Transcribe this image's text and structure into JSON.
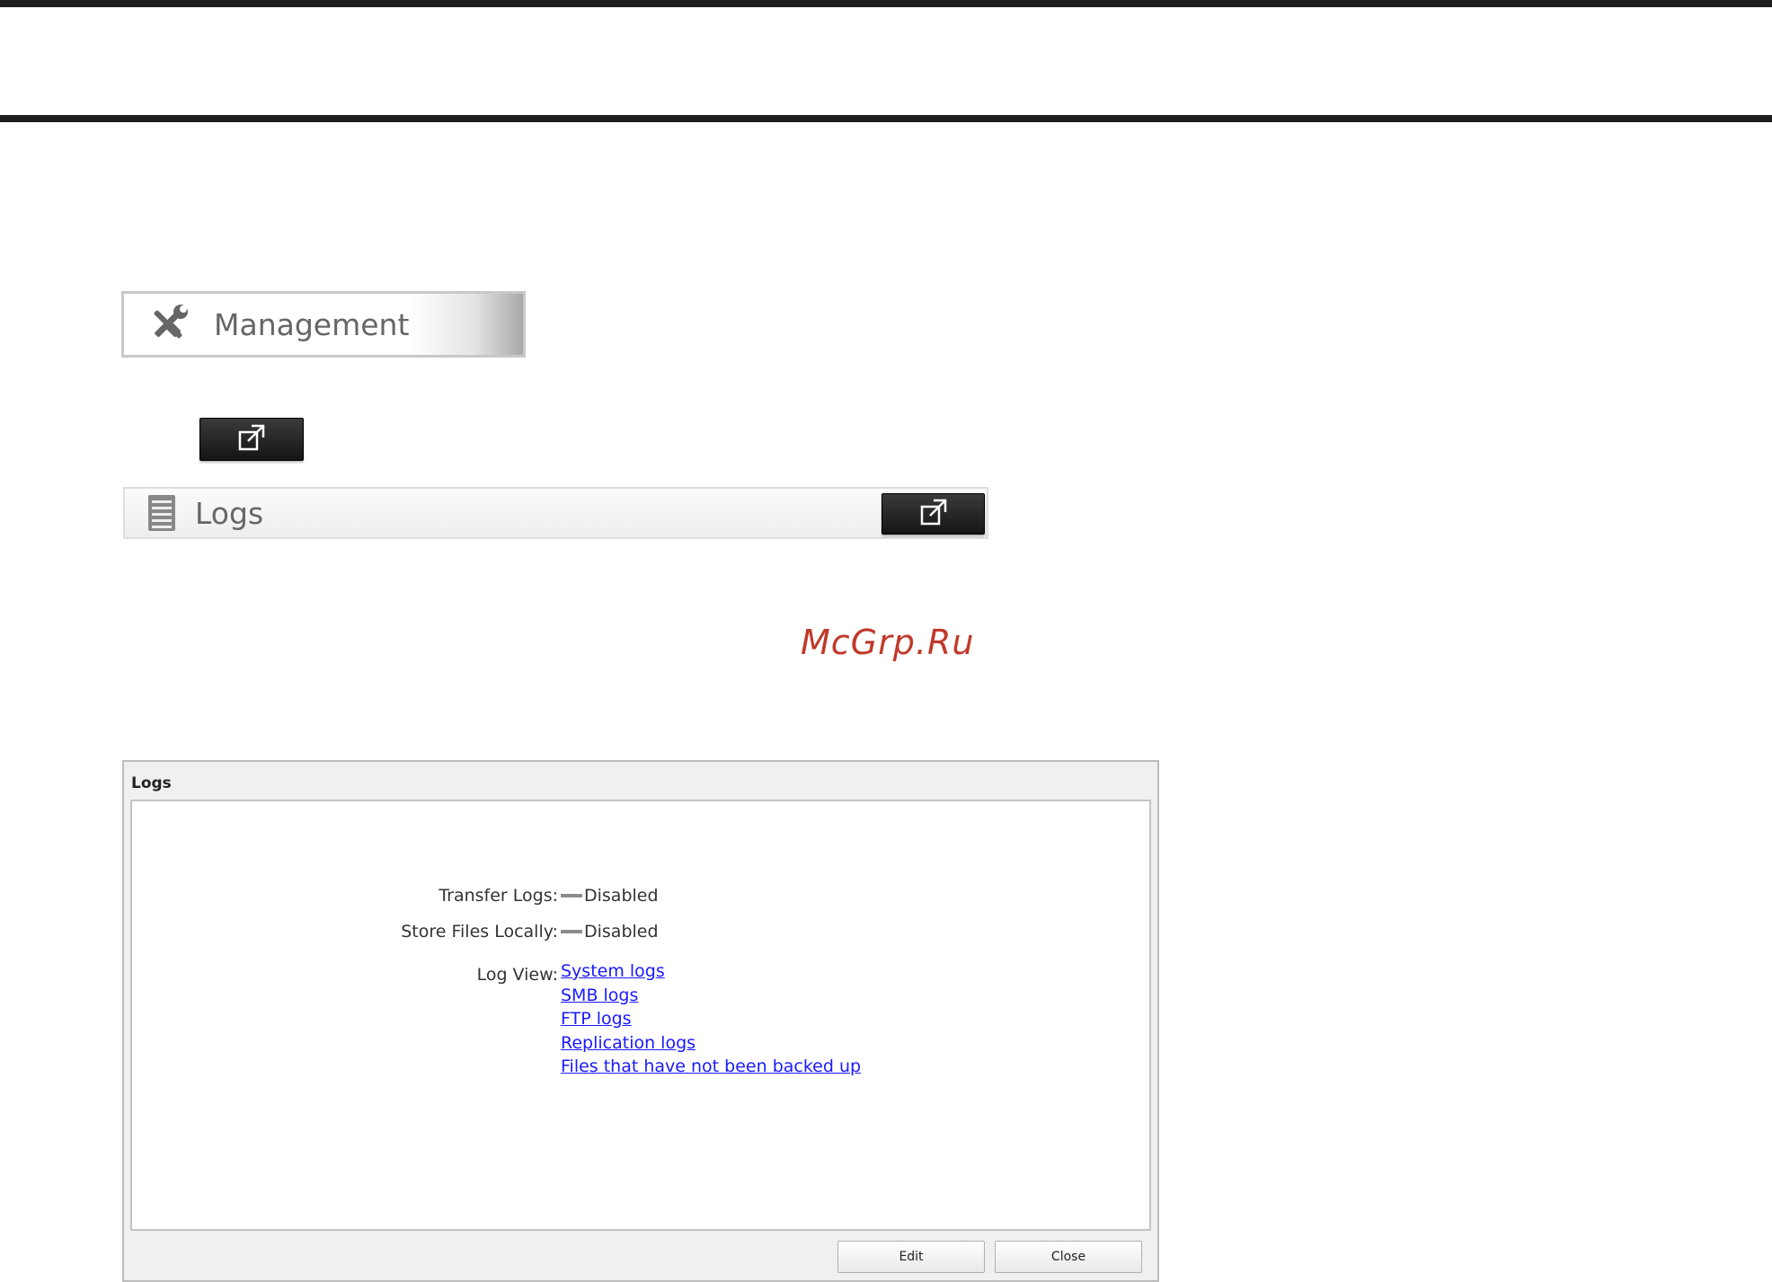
{
  "management": {
    "label": "Management",
    "icon": "tools-icon"
  },
  "open_button": {
    "icon": "open-window-icon"
  },
  "logs_bar": {
    "label": "Logs",
    "icon": "logs-list-icon",
    "button_icon": "open-window-icon"
  },
  "watermark": {
    "text": "McGrp.Ru"
  },
  "dialog": {
    "title": "Logs",
    "rows": {
      "transfer_logs": {
        "label": "Transfer Logs:",
        "value": "Disabled"
      },
      "store_files_locally": {
        "label": "Store Files Locally:",
        "value": "Disabled"
      },
      "log_view": {
        "label": "Log View:"
      }
    },
    "links": [
      "System logs",
      "SMB logs",
      "FTP logs",
      "Replication logs",
      "Files that have not been backed up"
    ],
    "buttons": {
      "edit": "Edit",
      "close": "Close"
    }
  }
}
